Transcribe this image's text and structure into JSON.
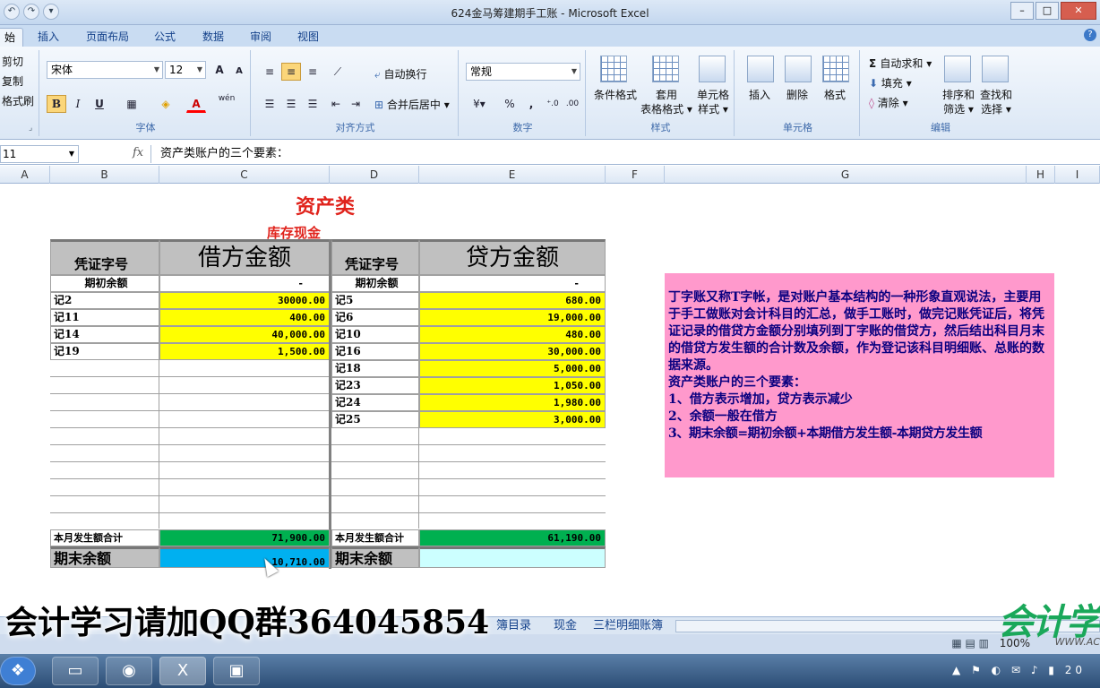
{
  "window": {
    "title": "624金马筹建期手工账 - Microsoft Excel"
  },
  "tabs": [
    "始",
    "插入",
    "页面布局",
    "公式",
    "数据",
    "审阅",
    "视图"
  ],
  "ribbon": {
    "clipboard": {
      "cut": "剪切",
      "copy": "复制",
      "format_painter": "格式刷"
    },
    "font": {
      "name": "宋体",
      "size": "12",
      "label": "字体",
      "bold": "B",
      "italic": "I",
      "underline": "U",
      "grow": "A",
      "shrink": "A",
      "wen": "wén"
    },
    "alignment": {
      "wrap": "自动换行",
      "merge": "合并后居中",
      "label": "对齐方式"
    },
    "number": {
      "format": "常规",
      "percent": "%",
      "comma": ",",
      "label": "数字"
    },
    "styles": {
      "conditional": "条件格式",
      "table1": "套用",
      "table2": "表格格式",
      "cell1": "单元格",
      "cell2": "样式",
      "label": "样式"
    },
    "cells": {
      "insert": "插入",
      "delete": "删除",
      "format": "格式",
      "label": "单元格"
    },
    "editing": {
      "autosum": "自动求和",
      "fill": "填充",
      "clear": "清除",
      "sort1": "排序和",
      "sort2": "筛选",
      "find1": "查找和",
      "find2": "选择",
      "label": "编辑"
    }
  },
  "formula_bar": {
    "name_box": "11",
    "fx": "fx",
    "content": "资产类账户的三个要素："
  },
  "columns": [
    "A",
    "B",
    "C",
    "D",
    "E",
    "F",
    "G",
    "H",
    "I"
  ],
  "sheet": {
    "title": "资产类",
    "subtitle": "库存现金",
    "header": {
      "voucher": "凭证字号",
      "debit": "借方金额",
      "credit": "贷方金额"
    },
    "opening_label": "期初余额",
    "opening_debit": "-",
    "opening_credit": "-",
    "debit_rows": [
      {
        "voucher": "记2",
        "amount": "30000.00"
      },
      {
        "voucher": "记11",
        "amount": "400.00"
      },
      {
        "voucher": "记14",
        "amount": "40,000.00"
      },
      {
        "voucher": "记19",
        "amount": "1,500.00"
      }
    ],
    "credit_rows": [
      {
        "voucher": "记5",
        "amount": "680.00"
      },
      {
        "voucher": "记6",
        "amount": "19,000.00"
      },
      {
        "voucher": "记10",
        "amount": "480.00"
      },
      {
        "voucher": "记16",
        "amount": "30,000.00"
      },
      {
        "voucher": "记18",
        "amount": "5,000.00"
      },
      {
        "voucher": "记23",
        "amount": "1,050.00"
      },
      {
        "voucher": "记24",
        "amount": "1,980.00"
      },
      {
        "voucher": "记25",
        "amount": "3,000.00"
      }
    ],
    "total_label": "本月发生额合计",
    "debit_total": "71,900.00",
    "credit_total": "61,190.00",
    "closing_label": "期末余额",
    "closing_debit": "10,710.00",
    "closing_credit": ""
  },
  "note": {
    "lines": [
      "丁字账又称T字帐，是对账户基本结构的一种形象直观说法，主要用于手工做账对会计科目的汇总，做手工账时，做完记账凭证后，将凭证记录的借贷方金额分别填列到丁字账的借贷方，然后结出科目月末的借贷方发生额的合计数及余额，作为登记该科目明细账、总账的数据来源。",
      "资产类账户的三个要素：",
      "1、借方表示增加，贷方表示减少",
      "2、余额一般在借方",
      "3、期末余额=期初余额+本期借方发生额-本期贷方发生额"
    ]
  },
  "sheet_tabs": [
    "簿目录",
    "现金",
    "三栏明细账簿"
  ],
  "status": {
    "zoom": "100%"
  },
  "overlay": {
    "watermark": "会计学习请加QQ群364045854",
    "logo": "会计学",
    "logo_url": "WWW.AC"
  },
  "taskbar": {
    "clock": "20"
  }
}
